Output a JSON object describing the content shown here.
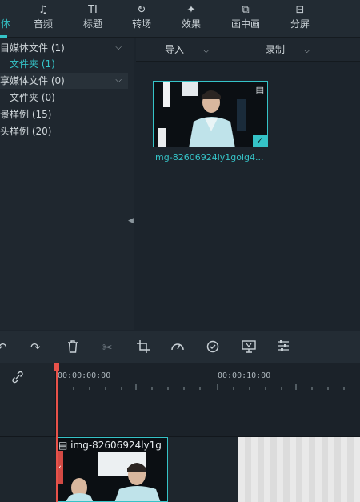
{
  "tabs": [
    {
      "icon": "media-icon",
      "label": "媒体",
      "glyph": "⌹",
      "visible_label": "体"
    },
    {
      "icon": "music-note-icon",
      "label": "音频",
      "glyph": "♫"
    },
    {
      "icon": "title-icon",
      "label": "标题",
      "glyph": "TI"
    },
    {
      "icon": "transition-icon",
      "label": "转场",
      "glyph": "↻"
    },
    {
      "icon": "effects-icon",
      "label": "效果",
      "glyph": "✦"
    },
    {
      "icon": "pip-icon",
      "label": "画中画",
      "glyph": "⧉"
    },
    {
      "icon": "split-screen-icon",
      "label": "分屏",
      "glyph": "⊟"
    }
  ],
  "sidebar": {
    "items": [
      {
        "label": "目媒体文件 (1)",
        "chevron": "⌵"
      },
      {
        "label": "文件夹 (1)"
      },
      {
        "label": "享媒体文件 (0)",
        "chevron": "⌵"
      },
      {
        "label": "文件夹 (0)"
      },
      {
        "label": "景样例 (15)"
      },
      {
        "label": "头样例 (20)"
      }
    ],
    "footer_icons": [
      "add-folder-icon",
      "remove-folder-icon"
    ]
  },
  "main": {
    "import_label": "导入",
    "record_label": "录制",
    "media_items": [
      {
        "name": "img-82606924ly1goig4...",
        "selected": true
      }
    ]
  },
  "toolbar": {
    "icons": [
      "undo-icon",
      "redo-icon",
      "delete-icon",
      "cut-icon",
      "crop-icon",
      "speed-icon",
      "color-icon",
      "green-screen-icon",
      "adjust-icon"
    ]
  },
  "timeline": {
    "timecodes": [
      "00:00:00:00",
      "00:00:10:00"
    ],
    "clip_title": "img-82606924ly1g"
  },
  "colors": {
    "accent": "#35c3c7",
    "playhead": "#e8524a",
    "background": "#1c242c"
  }
}
